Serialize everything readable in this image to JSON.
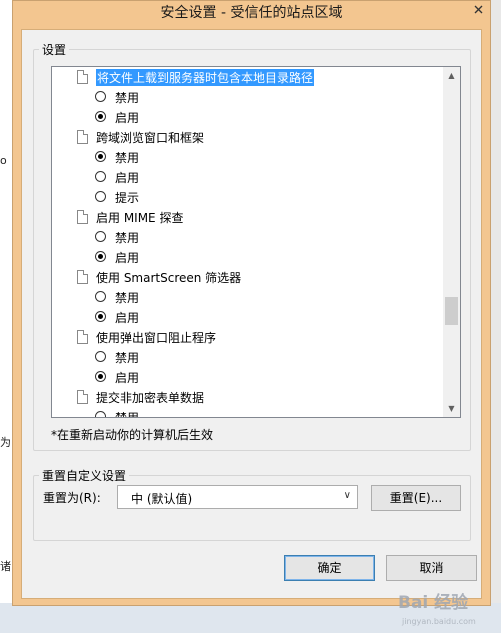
{
  "dialog": {
    "title": "安全设置 - 受信任的站点区域",
    "settings_group_label": "设置",
    "note": "*在重新启动你的计算机后生效",
    "reset_group_label": "重置自定义设置",
    "reset_for_label": "重置为(R):",
    "reset_select_value": "中 (默认值)",
    "reset_button": "重置(E)...",
    "ok_button": "确定",
    "cancel_button": "取消"
  },
  "settings": [
    {
      "label": "将文件上载到服务器时包含本地目录路径",
      "selected": true,
      "options": [
        {
          "label": "禁用",
          "checked": false
        },
        {
          "label": "启用",
          "checked": true
        }
      ]
    },
    {
      "label": "跨域浏览窗口和框架",
      "options": [
        {
          "label": "禁用",
          "checked": true
        },
        {
          "label": "启用",
          "checked": false
        },
        {
          "label": "提示",
          "checked": false
        }
      ]
    },
    {
      "label": "启用 MIME 探查",
      "options": [
        {
          "label": "禁用",
          "checked": false
        },
        {
          "label": "启用",
          "checked": true
        }
      ]
    },
    {
      "label": "使用 SmartScreen 筛选器",
      "options": [
        {
          "label": "禁用",
          "checked": false
        },
        {
          "label": "启用",
          "checked": true
        }
      ]
    },
    {
      "label": "使用弹出窗口阻止程序",
      "options": [
        {
          "label": "禁用",
          "checked": false
        },
        {
          "label": "启用",
          "checked": true
        }
      ]
    },
    {
      "label": "提交非加密表单数据",
      "options": [
        {
          "label": "禁用",
          "checked": false
        }
      ]
    }
  ],
  "background": {
    "edge_chars": [
      "o",
      "为",
      "诸"
    ]
  },
  "watermark": {
    "text": "Bai 经验",
    "sub": "jingyan.baidu.com"
  }
}
